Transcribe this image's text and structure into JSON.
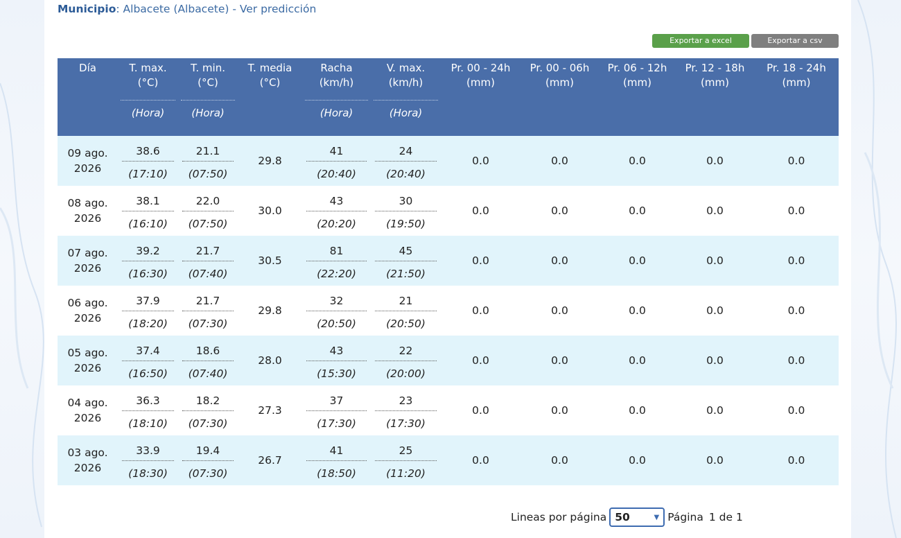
{
  "header": {
    "label": "Municipio",
    "separator": ":",
    "value": "Albacete (Albacete) - Ver predicción"
  },
  "buttons": {
    "excel": "Exportar a excel",
    "csv": "Exportar a csv",
    "excel_color": "#5aa04a",
    "csv_color": "#7f7f7f"
  },
  "columns": {
    "dia": "Día",
    "tmax": [
      "T. max.",
      "(°C)"
    ],
    "tmin": [
      "T. min.",
      "(°C)"
    ],
    "tmedia": [
      "T. media",
      "(°C)"
    ],
    "racha": [
      "Racha",
      "(km/h)"
    ],
    "vmax": [
      "V. max.",
      "(km/h)"
    ],
    "pr0024": [
      "Pr. 00 - 24h",
      "(mm)"
    ],
    "pr0006": [
      "Pr. 00 - 06h",
      "(mm)"
    ],
    "pr0612": [
      "Pr. 06 - 12h",
      "(mm)"
    ],
    "pr1218": [
      "Pr. 12 - 18h",
      "(mm)"
    ],
    "pr1824": [
      "Pr. 18 - 24h",
      "(mm)"
    ],
    "hora": "(Hora)"
  },
  "rows": [
    {
      "dia": [
        "09 ago.",
        "2026"
      ],
      "tmax": "38.6",
      "tmax_h": "(17:10)",
      "tmin": "21.1",
      "tmin_h": "(07:50)",
      "tmedia": "29.8",
      "racha": "41",
      "racha_h": "(20:40)",
      "vmax": "24",
      "vmax_h": "(20:40)",
      "p1": "0.0",
      "p2": "0.0",
      "p3": "0.0",
      "p4": "0.0",
      "p5": "0.0"
    },
    {
      "dia": [
        "08 ago.",
        "2026"
      ],
      "tmax": "38.1",
      "tmax_h": "(16:10)",
      "tmin": "22.0",
      "tmin_h": "(07:50)",
      "tmedia": "30.0",
      "racha": "43",
      "racha_h": "(20:20)",
      "vmax": "30",
      "vmax_h": "(19:50)",
      "p1": "0.0",
      "p2": "0.0",
      "p3": "0.0",
      "p4": "0.0",
      "p5": "0.0"
    },
    {
      "dia": [
        "07 ago.",
        "2026"
      ],
      "tmax": "39.2",
      "tmax_h": "(16:30)",
      "tmin": "21.7",
      "tmin_h": "(07:40)",
      "tmedia": "30.5",
      "racha": "81",
      "racha_h": "(22:20)",
      "vmax": "45",
      "vmax_h": "(21:50)",
      "p1": "0.0",
      "p2": "0.0",
      "p3": "0.0",
      "p4": "0.0",
      "p5": "0.0"
    },
    {
      "dia": [
        "06 ago.",
        "2026"
      ],
      "tmax": "37.9",
      "tmax_h": "(18:20)",
      "tmin": "21.7",
      "tmin_h": "(07:30)",
      "tmedia": "29.8",
      "racha": "32",
      "racha_h": "(20:50)",
      "vmax": "21",
      "vmax_h": "(20:50)",
      "p1": "0.0",
      "p2": "0.0",
      "p3": "0.0",
      "p4": "0.0",
      "p5": "0.0"
    },
    {
      "dia": [
        "05 ago.",
        "2026"
      ],
      "tmax": "37.4",
      "tmax_h": "(16:50)",
      "tmin": "18.6",
      "tmin_h": "(07:40)",
      "tmedia": "28.0",
      "racha": "43",
      "racha_h": "(15:30)",
      "vmax": "22",
      "vmax_h": "(20:00)",
      "p1": "0.0",
      "p2": "0.0",
      "p3": "0.0",
      "p4": "0.0",
      "p5": "0.0"
    },
    {
      "dia": [
        "04 ago.",
        "2026"
      ],
      "tmax": "36.3",
      "tmax_h": "(18:10)",
      "tmin": "18.2",
      "tmin_h": "(07:30)",
      "tmedia": "27.3",
      "racha": "37",
      "racha_h": "(17:30)",
      "vmax": "23",
      "vmax_h": "(17:30)",
      "p1": "0.0",
      "p2": "0.0",
      "p3": "0.0",
      "p4": "0.0",
      "p5": "0.0"
    },
    {
      "dia": [
        "03 ago.",
        "2026"
      ],
      "tmax": "33.9",
      "tmax_h": "(18:30)",
      "tmin": "19.4",
      "tmin_h": "(07:30)",
      "tmedia": "26.7",
      "racha": "41",
      "racha_h": "(18:50)",
      "vmax": "25",
      "vmax_h": "(11:20)",
      "p1": "0.0",
      "p2": "0.0",
      "p3": "0.0",
      "p4": "0.0",
      "p5": "0.0"
    }
  ],
  "pagination": {
    "lines_label": "Lineas por página",
    "per_page": "50",
    "page_label": "Página",
    "page_current": "1",
    "of_label": "de",
    "page_total": "1"
  },
  "colors": {
    "header_bg": "#4a6ea9",
    "row_alt": "#e1f4fb",
    "link": "#3b6aa3"
  }
}
